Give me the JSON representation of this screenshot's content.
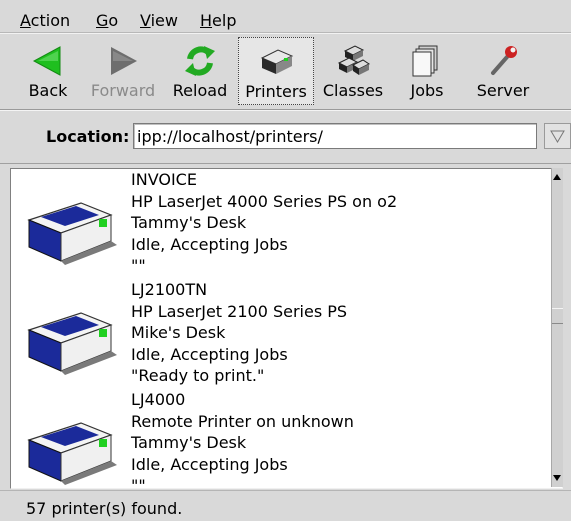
{
  "menubar": {
    "items": [
      {
        "label": "Action",
        "ul": "A",
        "rest": "ction"
      },
      {
        "label": "Go",
        "ul": "G",
        "rest": "o"
      },
      {
        "label": "View",
        "ul": "V",
        "rest": "iew"
      },
      {
        "label": "Help",
        "ul": "H",
        "rest": "elp"
      }
    ]
  },
  "toolbar": {
    "back_label": "Back",
    "forward_label": "Forward",
    "reload_label": "Reload",
    "printers_label": "Printers",
    "classes_label": "Classes",
    "jobs_label": "Jobs",
    "server_label": "Server",
    "forward_enabled": false,
    "active": "Printers"
  },
  "location": {
    "label": "Location:",
    "value": "ipp://localhost/printers/"
  },
  "printers": [
    {
      "name": "INVOICE",
      "model": "HP LaserJet 4000 Series PS on o2",
      "location": "Tammy's Desk",
      "state": "Idle, Accepting Jobs",
      "message": "\"\""
    },
    {
      "name": "LJ2100TN",
      "model": "HP LaserJet 2100 Series PS",
      "location": "Mike's Desk",
      "state": "Idle, Accepting Jobs",
      "message": "\"Ready to print.\""
    },
    {
      "name": "LJ4000",
      "model": "Remote Printer on unknown",
      "location": "Tammy's Desk",
      "state": "Idle, Accepting Jobs",
      "message": "\"\""
    }
  ],
  "status": {
    "text": "57 printer(s) found."
  },
  "colors": {
    "back_arrow": "#1fbf1f",
    "forward_arrow": "#6e6e6e",
    "reload": "#22aa22",
    "printer_blue": "#1b2a9a",
    "printer_led": "#20d020"
  },
  "icons": {
    "back": "back-arrow-icon",
    "forward": "forward-arrow-icon",
    "reload": "reload-icon",
    "printers": "printer-icon",
    "classes": "classes-icon",
    "jobs": "jobs-icon",
    "server": "server-wrench-icon"
  }
}
